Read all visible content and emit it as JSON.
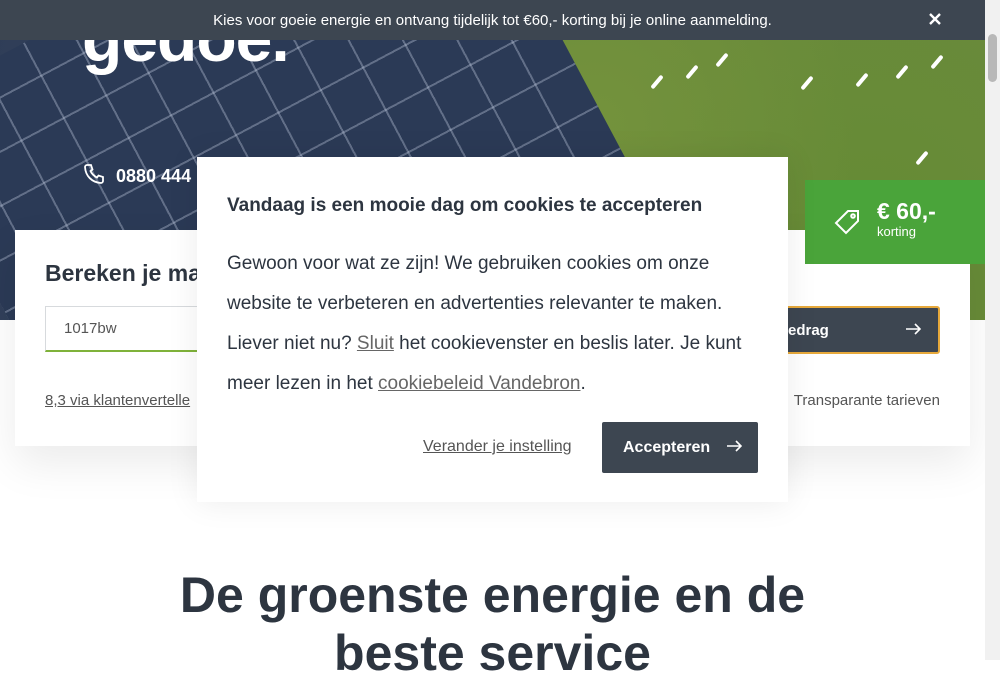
{
  "topbar": {
    "message": "Kies voor goeie energie en ontvang tijdelijk tot €60,- korting bij je online aanmelding.",
    "close_icon": "close-icon",
    "background": "#3d4651"
  },
  "hero": {
    "title": "gedoe.",
    "phone": "0880 444",
    "phone_icon": "phone-icon"
  },
  "calculator": {
    "title": "Bereken je ma",
    "postcode_value": "1017bw",
    "button_label": "edrag",
    "reviews_link": "8,3 via klantenvertelle",
    "tariffs_text": "Transparante tarieven"
  },
  "discount": {
    "amount": "€ 60,-",
    "label": "korting",
    "icon": "tag-icon",
    "color": "#4aa43a"
  },
  "cookie": {
    "title": "Vandaag is een mooie dag om cookies te accepteren",
    "body_part1": "Gewoon voor wat ze zijn! We gebruiken cookies om onze website te verbeteren en advertenties relevanter te maken. Liever niet nu? ",
    "sluit_link": "Sluit",
    "body_part2": " het cookievenster en beslis later. Je kunt meer lezen in het ",
    "policy_link": "cookiebeleid Vandebron",
    "body_part3": ".",
    "change_settings": "Verander je instelling",
    "accept_label": "Accepteren"
  },
  "section": {
    "title_line1": "De groenste energie en de",
    "title_line2": "beste service"
  },
  "colors": {
    "accent_green": "#4aa43a",
    "dark": "#3d4651",
    "button_border": "#e7a93b"
  }
}
